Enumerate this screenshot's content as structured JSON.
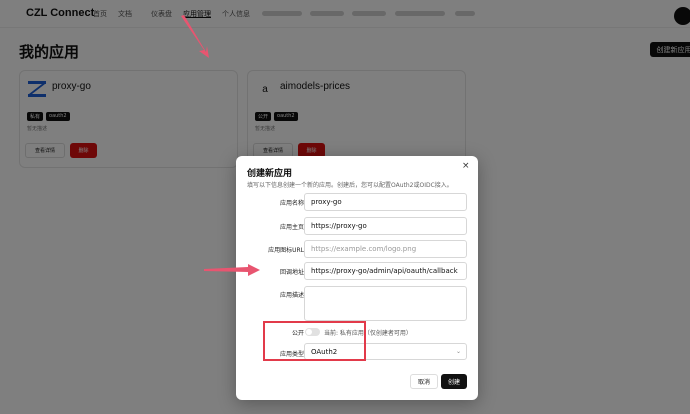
{
  "header": {
    "brand": "CZL Connect",
    "nav": [
      "首页",
      "文档",
      "仪表盘",
      "应用管理",
      "个人信息"
    ],
    "active_nav": "应用管理"
  },
  "page": {
    "title": "我的应用",
    "create_button": "创建新应用"
  },
  "apps": [
    {
      "name": "proxy-go",
      "logo_letter": "",
      "tags": [
        "私有",
        "oauth2"
      ],
      "description": "暂无描述",
      "view_label": "查看详情",
      "delete_label": "删除"
    },
    {
      "name": "aimodels-prices",
      "logo_letter": "a",
      "tags": [
        "公开",
        "oauth2"
      ],
      "description": "暂无描述",
      "view_label": "查看详情",
      "delete_label": "删除"
    }
  ],
  "dialog": {
    "title": "创建新应用",
    "subtitle": "填写以下信息创建一个新的应用。创建后，您可以配置OAuth2或OIDC接入。",
    "close_icon": "×",
    "fields": {
      "name": {
        "label": "应用名称",
        "value": "proxy-go"
      },
      "homepage": {
        "label": "应用主页",
        "value": "https://proxy-go"
      },
      "icon_url": {
        "label": "应用图标URL",
        "placeholder": "https://example.com/logo.png"
      },
      "callback": {
        "label": "回调地址",
        "value": "https://proxy-go/admin/api/oauth/callback"
      },
      "description": {
        "label": "应用描述",
        "value": ""
      },
      "public": {
        "label": "公开",
        "state_text": "当前: 私有应用（仅创建者可用）",
        "enabled": false
      },
      "type": {
        "label": "应用类型",
        "value": "OAuth2"
      }
    },
    "cancel_label": "取消",
    "submit_label": "创建"
  },
  "annotations": {
    "highlight_color": "#e23a4a"
  }
}
